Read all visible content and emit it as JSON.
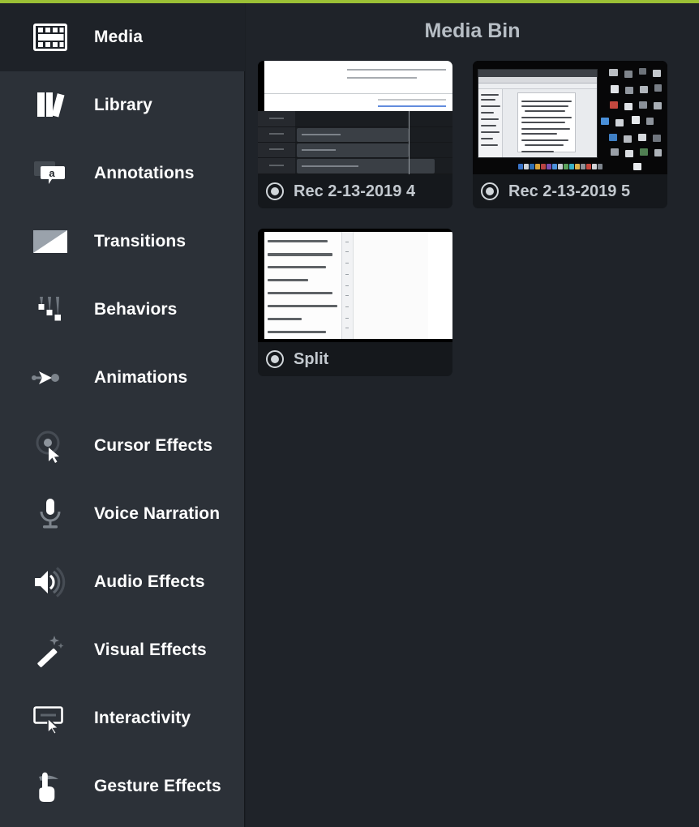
{
  "theme": {
    "accent_line_color": "#9bc035",
    "sidebar_bg": "#2c3138",
    "sidebar_selected_bg": "#1e2228",
    "main_bg": "#1f2329",
    "card_bg": "#15181c",
    "label_color": "#ffffff",
    "title_color": "#b7bec5",
    "caption_color": "#c3c9cf"
  },
  "sidebar": {
    "items": [
      {
        "label": "Media",
        "icon": "filmstrip-icon",
        "selected": true
      },
      {
        "label": "Library",
        "icon": "books-icon",
        "selected": false
      },
      {
        "label": "Annotations",
        "icon": "speech-bubble-a-icon",
        "selected": false
      },
      {
        "label": "Transitions",
        "icon": "diagonal-split-icon",
        "selected": false
      },
      {
        "label": "Behaviors",
        "icon": "motion-trails-icon",
        "selected": false
      },
      {
        "label": "Animations",
        "icon": "arrow-keyframe-icon",
        "selected": false
      },
      {
        "label": "Cursor Effects",
        "icon": "cursor-ring-icon",
        "selected": false
      },
      {
        "label": "Voice Narration",
        "icon": "microphone-icon",
        "selected": false
      },
      {
        "label": "Audio Effects",
        "icon": "speaker-waves-icon",
        "selected": false
      },
      {
        "label": "Visual Effects",
        "icon": "magic-wand-icon",
        "selected": false
      },
      {
        "label": "Interactivity",
        "icon": "screen-cursor-icon",
        "selected": false
      },
      {
        "label": "Gesture Effects",
        "icon": "pointing-hand-icon",
        "selected": false
      }
    ]
  },
  "main": {
    "title": "Media Bin",
    "items": [
      {
        "name": "Rec 2-13-2019 4",
        "icon": "record-icon",
        "thumbnail": "timeline-screenshot"
      },
      {
        "name": "Rec 2-13-2019 5",
        "icon": "record-icon",
        "thumbnail": "desktop-screenshot"
      },
      {
        "name": "Split",
        "icon": "record-icon",
        "thumbnail": "document-outline-screenshot"
      }
    ]
  }
}
